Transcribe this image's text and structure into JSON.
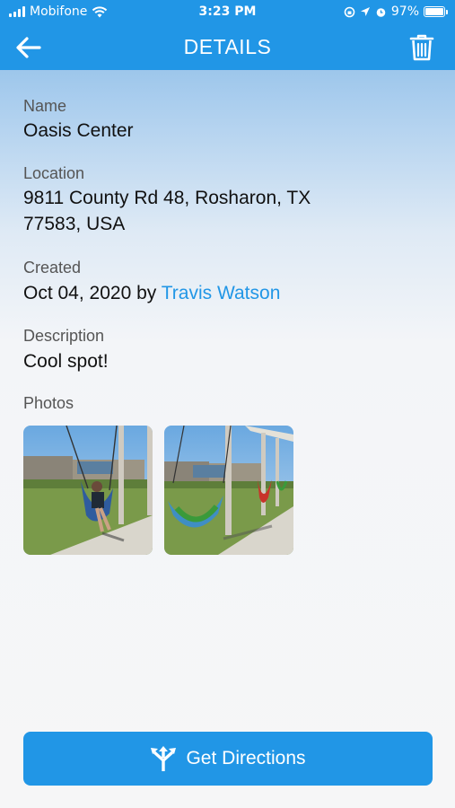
{
  "status_bar": {
    "carrier": "Mobifone",
    "time": "3:23 PM",
    "battery": "97%"
  },
  "nav": {
    "title": "DETAILS",
    "back_icon": "arrow-left-icon",
    "delete_icon": "trash-icon"
  },
  "details": {
    "name_label": "Name",
    "name_value": "Oasis Center",
    "location_label": "Location",
    "location_line1": "9811 County Rd 48, Rosharon, TX",
    "location_line2": "77583, USA",
    "created_label": "Created",
    "created_date": "Oct 04, 2020 by",
    "created_by": "Travis Watson",
    "description_label": "Description",
    "description_value": "Cool spot!",
    "photos_label": "Photos"
  },
  "photos": [
    {
      "name": "photo-person-hammock"
    },
    {
      "name": "photo-empty-hammocks"
    }
  ],
  "action": {
    "label": "Get Directions",
    "icon": "directions-icon"
  },
  "colors": {
    "accent": "#2196e6",
    "link": "#2196e6"
  }
}
